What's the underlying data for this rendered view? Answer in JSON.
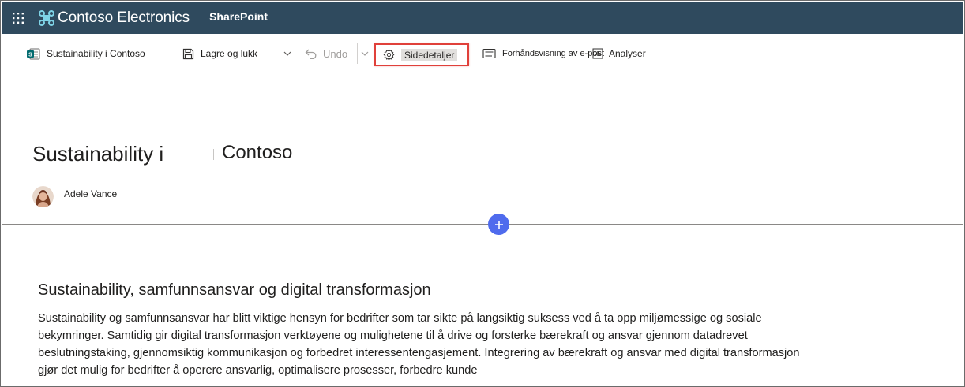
{
  "suite": {
    "brand_name": "Contoso Electronics",
    "app_name": "SharePoint",
    "waffle_icon": "waffle-icon",
    "brand_icon": "contoso-logo"
  },
  "toolbar": {
    "site_label": "Sustainability i Contoso",
    "save_label": "Lagre og lukk",
    "undo_label": "Undo",
    "details_label": "Sidedetaljer",
    "preview_label": "Forhåndsvisning av e-post",
    "analyze_label": "Analyser"
  },
  "page": {
    "title_part1": "Sustainability i",
    "title_part2": "Contoso",
    "author": "Adele Vance"
  },
  "content": {
    "heading": "Sustainability, samfunnsansvar og digital transformasjon",
    "paragraph": "Sustainability og samfunnsansvar har blitt viktige hensyn for bedrifter som tar sikte på langsiktig suksess ved å ta opp miljømessige og sosiale bekymringer. Samtidig gir digital transformasjon verktøyene og mulighetene til å drive og forsterke bærekraft og ansvar gjennom datadrevet beslutningstaking, gjennomsiktig kommunikasjon og forbedret interessentengasjement. Integrering av bærekraft og ansvar med digital transformasjon gjør det mulig for bedrifter å operere ansvarlig, optimalisere prosesser, forbedre kunde"
  },
  "colors": {
    "suite_bar": "#2f4a5e",
    "highlight_border": "#e0403a",
    "add_button": "#4f6bed"
  }
}
